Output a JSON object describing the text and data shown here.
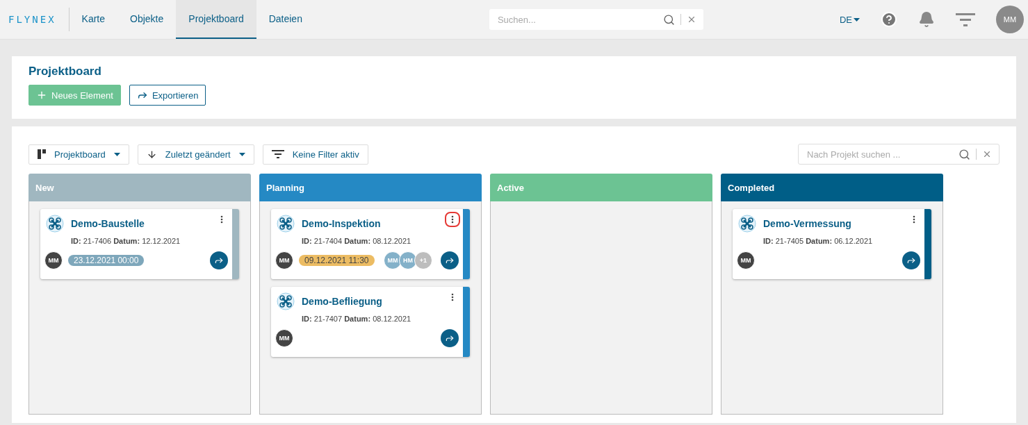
{
  "header": {
    "logo": "FLYNEX",
    "nav": [
      {
        "label": "Karte",
        "selected": false
      },
      {
        "label": "Objekte",
        "selected": false
      },
      {
        "label": "Projektboard",
        "selected": true
      },
      {
        "label": "Dateien",
        "selected": false
      }
    ],
    "search": {
      "placeholder": "Suchen..."
    },
    "language": "DE",
    "avatar": "MM"
  },
  "page": {
    "title": "Projektboard",
    "actions": [
      {
        "kind": "primary",
        "label": "Neues Element"
      },
      {
        "kind": "outline",
        "label": "Exportieren"
      }
    ]
  },
  "toolbar": {
    "view": "Projektboard",
    "sort": "Zuletzt geändert",
    "filter": "Keine Filter aktiv",
    "search": {
      "placeholder": "Nach Projekt suchen ..."
    }
  },
  "columns": [
    {
      "title": "New",
      "color": "#a0b7c0",
      "cards": [
        {
          "title": "Demo-Baustelle",
          "id_label": "ID:",
          "id": "21-7406",
          "date_label": "Datum:",
          "date": "12.12.2021",
          "owner": "MM",
          "deadline": {
            "text": "23.12.2021 00:00",
            "color": "#7ea7bb"
          },
          "highlighted": false
        }
      ]
    },
    {
      "title": "Planning",
      "color": "#2589c4",
      "cards": [
        {
          "title": "Demo-Inspektion",
          "id_label": "ID:",
          "id": "21-7404",
          "date_label": "Datum:",
          "date": "08.12.2021",
          "owner": "MM",
          "deadline": {
            "text": "09.12.2021 11:30",
            "color": "#ecbc63"
          },
          "assignees": [
            {
              "text": "MM",
              "color": "#84b1c9"
            },
            {
              "text": "HM",
              "color": "#84b1c9"
            },
            {
              "text": "+1",
              "color": "#bdbdbd"
            }
          ],
          "highlighted": true
        },
        {
          "title": "Demo-Befliegung",
          "id_label": "ID:",
          "id": "21-7407",
          "date_label": "Datum:",
          "date": "08.12.2021",
          "owner": "MM",
          "highlighted": false
        }
      ]
    },
    {
      "title": "Active",
      "color": "#6cc393"
    },
    {
      "title": "Completed",
      "color": "#005e87",
      "cards": [
        {
          "title": "Demo-Vermessung",
          "id_label": "ID:",
          "id": "21-7405",
          "date_label": "Datum:",
          "date": "06.12.2021",
          "owner": "MM",
          "highlighted": false
        }
      ]
    }
  ]
}
